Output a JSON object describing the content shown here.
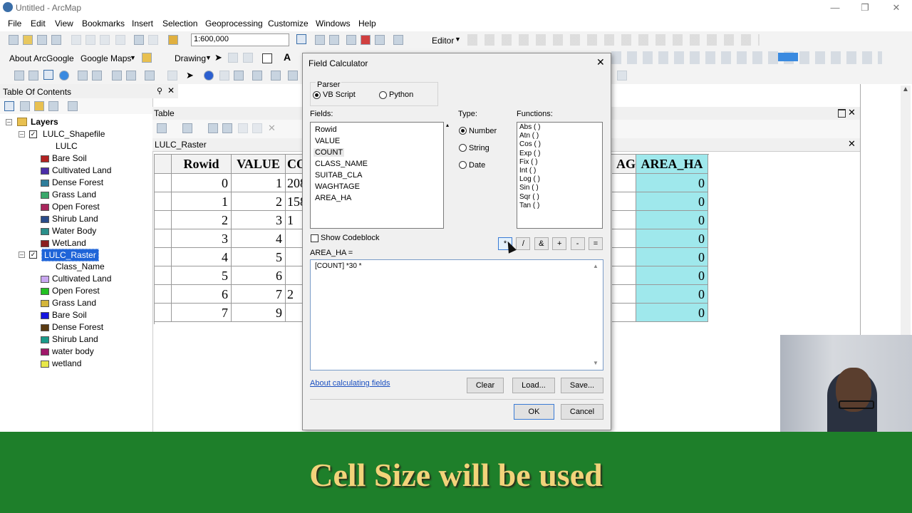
{
  "window": {
    "title": "Untitled - ArcMap"
  },
  "menu": [
    "File",
    "Edit",
    "View",
    "Bookmarks",
    "Insert",
    "Selection",
    "Geoprocessing",
    "Customize",
    "Windows",
    "Help"
  ],
  "toolbar": {
    "scale": "1:600,000",
    "editor_label": "Editor",
    "about_arcgoogle": "About ArcGoogle",
    "google_maps": "Google Maps",
    "drawing": "Drawing"
  },
  "toc": {
    "title": "Table Of Contents",
    "root": "Layers",
    "layers": [
      {
        "name": "LULC_Shapefile",
        "field": "LULC",
        "selected": false,
        "classes": [
          {
            "label": "Bare Soil",
            "color": "#b22222"
          },
          {
            "label": "Cultivated Land",
            "color": "#4b2ea8"
          },
          {
            "label": "Dense Forest",
            "color": "#2e7d9a"
          },
          {
            "label": "Grass Land",
            "color": "#3aa86b"
          },
          {
            "label": "Open Forest",
            "color": "#a8265c"
          },
          {
            "label": "Shirub Land",
            "color": "#2a4c8a"
          },
          {
            "label": "Water Body",
            "color": "#2a8f8a"
          },
          {
            "label": "WetLand",
            "color": "#8a1f1f"
          }
        ]
      },
      {
        "name": "LULC_Raster",
        "field": "Class_Name",
        "selected": true,
        "classes": [
          {
            "label": "Cultivated Land",
            "color": "#c8a6f0"
          },
          {
            "label": "Open Forest",
            "color": "#22c022"
          },
          {
            "label": "Grass Land",
            "color": "#d4b53a"
          },
          {
            "label": "Bare Soil",
            "color": "#1515e0"
          },
          {
            "label": "Dense Forest",
            "color": "#5a3a12"
          },
          {
            "label": "Shirub Land",
            "color": "#1a9a8a"
          },
          {
            "label": "water body",
            "color": "#a0186a"
          },
          {
            "label": "wetland",
            "color": "#e8e84a"
          }
        ]
      }
    ]
  },
  "table": {
    "title": "Table",
    "tab": "LULC_Raster",
    "headers": [
      "Rowid",
      "VALUE",
      "CO",
      "AG",
      "AREA_HA"
    ],
    "rows": [
      {
        "rowid": "0",
        "value": "1",
        "count": "208",
        "area": "0"
      },
      {
        "rowid": "1",
        "value": "2",
        "count": "158",
        "area": "0"
      },
      {
        "rowid": "2",
        "value": "3",
        "count": "1",
        "area": "0"
      },
      {
        "rowid": "3",
        "value": "4",
        "count": "",
        "area": "0"
      },
      {
        "rowid": "4",
        "value": "5",
        "count": "",
        "area": "0"
      },
      {
        "rowid": "5",
        "value": "6",
        "count": "",
        "area": "0"
      },
      {
        "rowid": "6",
        "value": "7",
        "count": "2",
        "area": "0"
      },
      {
        "rowid": "7",
        "value": "9",
        "count": "",
        "area": "0"
      }
    ]
  },
  "dialog": {
    "title": "Field Calculator",
    "parser_label": "Parser",
    "parser_vb": "VB Script",
    "parser_python": "Python",
    "fields_label": "Fields:",
    "fields": [
      "Rowid",
      "VALUE",
      "COUNT",
      "CLASS_NAME",
      "SUITAB_CLA",
      "WAGHTAGE",
      "AREA_HA"
    ],
    "type_label": "Type:",
    "types": [
      "Number",
      "String",
      "Date"
    ],
    "functions_label": "Functions:",
    "functions": [
      "Abs ( )",
      "Atn ( )",
      "Cos ( )",
      "Exp ( )",
      "Fix ( )",
      "Int ( )",
      "Log ( )",
      "Sin ( )",
      "Sqr ( )",
      "Tan ( )"
    ],
    "show_codeblock": "Show Codeblock",
    "operators": [
      "*",
      "/",
      "&",
      "+",
      "-",
      "="
    ],
    "expression_label": "AREA_HA =",
    "expression": "[COUNT] *30 *",
    "about_link": "About calculating fields",
    "clear": "Clear",
    "load": "Load...",
    "save": "Save...",
    "ok": "OK",
    "cancel": "Cancel"
  },
  "caption": "Cell Size will be used"
}
